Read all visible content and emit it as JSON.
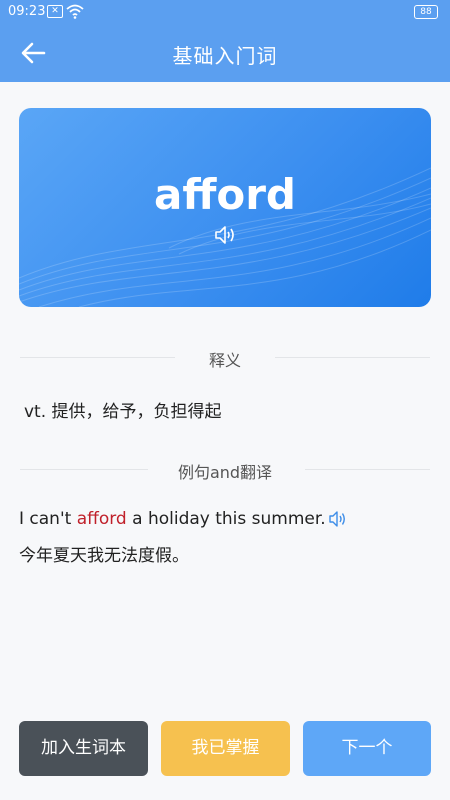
{
  "status": {
    "time": "09:23",
    "notif_icon": "x-icon",
    "battery": "88"
  },
  "header": {
    "title": "基础入门词",
    "back_icon": "arrow-left-icon"
  },
  "card": {
    "word": "afford",
    "speaker_icon": "speaker-icon"
  },
  "section_meaning": {
    "label": "释义"
  },
  "definition": "vt. 提供，给予，负担得起",
  "section_example": {
    "label": "例句and翻译"
  },
  "example": {
    "before": "I can't ",
    "highlight": "afford",
    "after": " a holiday this summer.",
    "translation": "今年夏天我无法度假。"
  },
  "buttons": {
    "add": "加入生词本",
    "mastered": "我已掌握",
    "next": "下一个"
  },
  "colors": {
    "primary": "#5b9ff0",
    "highlight": "#c0202a",
    "dark_button": "#4a5158",
    "yellow_button": "#f6c14f",
    "blue_button": "#5ea7f7"
  }
}
